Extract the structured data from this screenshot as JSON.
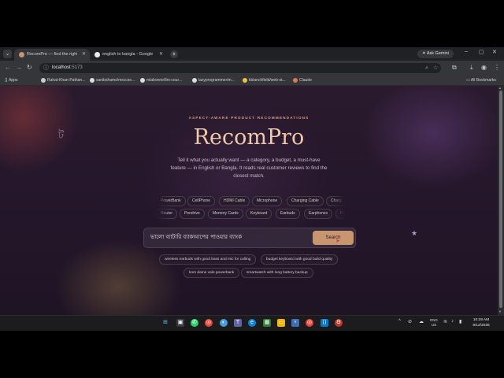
{
  "browser": {
    "tabs": [
      {
        "title": "RecomPro — find the right pro...",
        "active": true
      },
      {
        "title": "english to bangla - Google Se...",
        "active": false
      }
    ],
    "ask_gemini": "Ask Gemini",
    "address": {
      "host": "localhost",
      "port": ":5173"
    },
    "bookmarks": {
      "apps": "Apps",
      "items": [
        "Rahat-Khan-Pathan...",
        "sanibshams/msccse...",
        "mlabonne/llm-cour...",
        "lazyprogrammer/m...",
        "kblanchfield/web-st...",
        "Claude"
      ],
      "all": "All Bookmarks"
    }
  },
  "page": {
    "eyebrow": "ASPECT-AWARE PRODUCT RECOMMENDATIONS",
    "title": "RecomPro",
    "description": "Tell it what you actually want — a category, a budget, a must-have feature — in English or Bangla. It reads real customer reviews to find the closest match.",
    "chips_row1": [
      "PowerBank",
      "CellPhone",
      "HDMI Cable",
      "Microphone",
      "Charging Cable",
      "Charg"
    ],
    "chips_row2": [
      "Router",
      "Pendrive",
      "Memory Cards",
      "Keyboard",
      "Earbuds",
      "Earphones",
      "Po"
    ],
    "search": {
      "value": "ভালো ব্যাটারি ব্যাকআপের পাওয়ার ব্যাংক",
      "button": "Search"
    },
    "suggestions": [
      "wireless earbuds with good bass and mic for calling",
      "budget keyboard with good build quality",
      "kom dame valo powerbank",
      "smartwatch with long battery backup"
    ],
    "deco_glyph": "ট"
  },
  "taskbar": {
    "lang": [
      "ENG",
      "US"
    ],
    "time": "10:28 AM",
    "date": "8/12/2026"
  }
}
